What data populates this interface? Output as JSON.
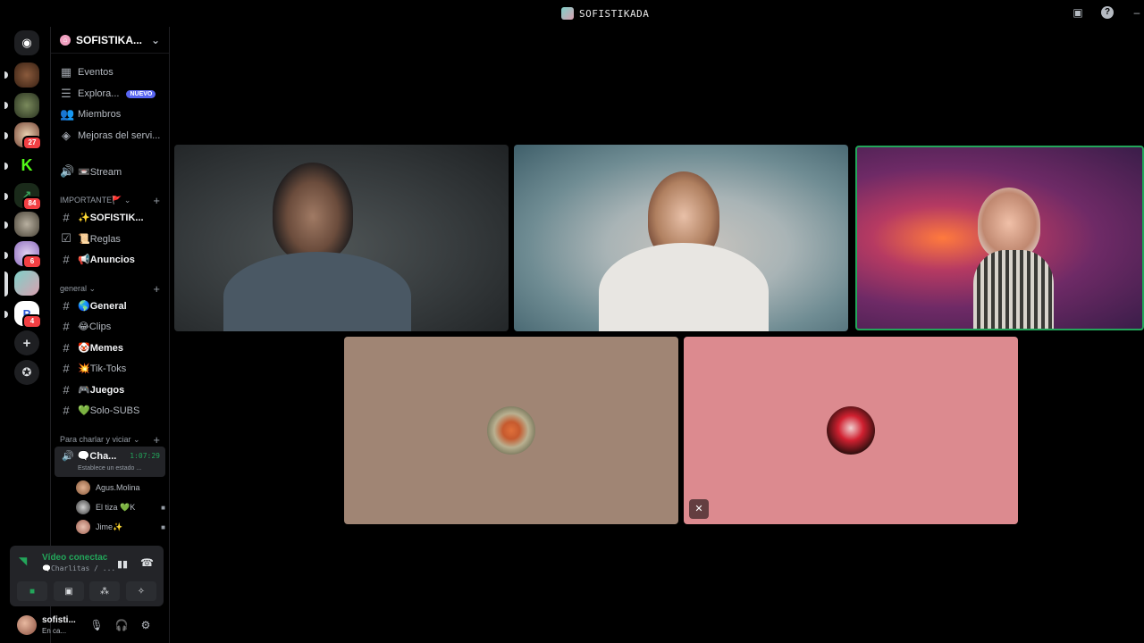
{
  "window": {
    "title": "SOFISTIKADA"
  },
  "rail": {
    "badges": [
      "27",
      "84",
      "6",
      "4"
    ]
  },
  "guild": {
    "name": "SOFISTIKA..."
  },
  "nav": {
    "eventos": "Eventos",
    "explorar": "Explora...",
    "nuevo": "NUEVO",
    "miembros": "Miembros",
    "mejoras": "Mejoras del servi..."
  },
  "stream_channel": "📼Stream",
  "categories": {
    "importante": "IMPORTANTE🚩",
    "general": "general",
    "charlar": "Para charlar y viciar"
  },
  "channels": {
    "sofistik": "✨SOFISTIK...",
    "reglas": "📜Reglas",
    "anuncios": "📢Anuncios",
    "general": "🌎General",
    "clips": "😂Clips",
    "memes": "🤡Memes",
    "tiktoks": "💥Tik-Toks",
    "juegos": "🎮Juegos",
    "solo_subs": "💚Solo-SUBS"
  },
  "voice_channel": {
    "name": "🗨️Cha...",
    "timer": "1:07:29",
    "status": "Establece un estado ..."
  },
  "voice_users": [
    {
      "name": "Agus.Molina"
    },
    {
      "name": "El tiza 💚K"
    },
    {
      "name": "Jime✨"
    }
  ],
  "voice_connected": {
    "title": "Vídeo conectac",
    "channel": "🗨️Charlitas / ..."
  },
  "user": {
    "name": "sofisti...",
    "status": "En ca..."
  }
}
